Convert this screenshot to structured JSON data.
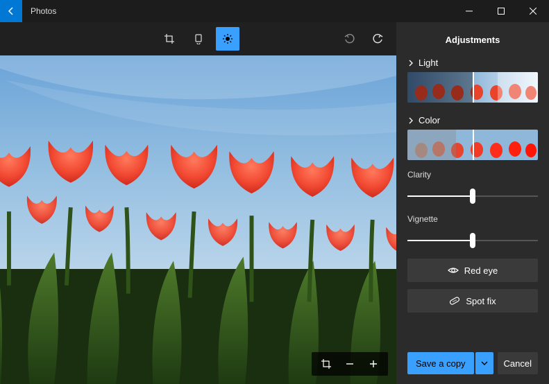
{
  "app": {
    "title": "Photos"
  },
  "panel": {
    "title": "Adjustments",
    "light_label": "Light",
    "color_label": "Color",
    "clarity_label": "Clarity",
    "vignette_label": "Vignette",
    "clarity_value": 50,
    "vignette_value": 50,
    "redeye_label": "Red eye",
    "spotfix_label": "Spot fix"
  },
  "footer": {
    "save_label": "Save a copy",
    "cancel_label": "Cancel"
  }
}
